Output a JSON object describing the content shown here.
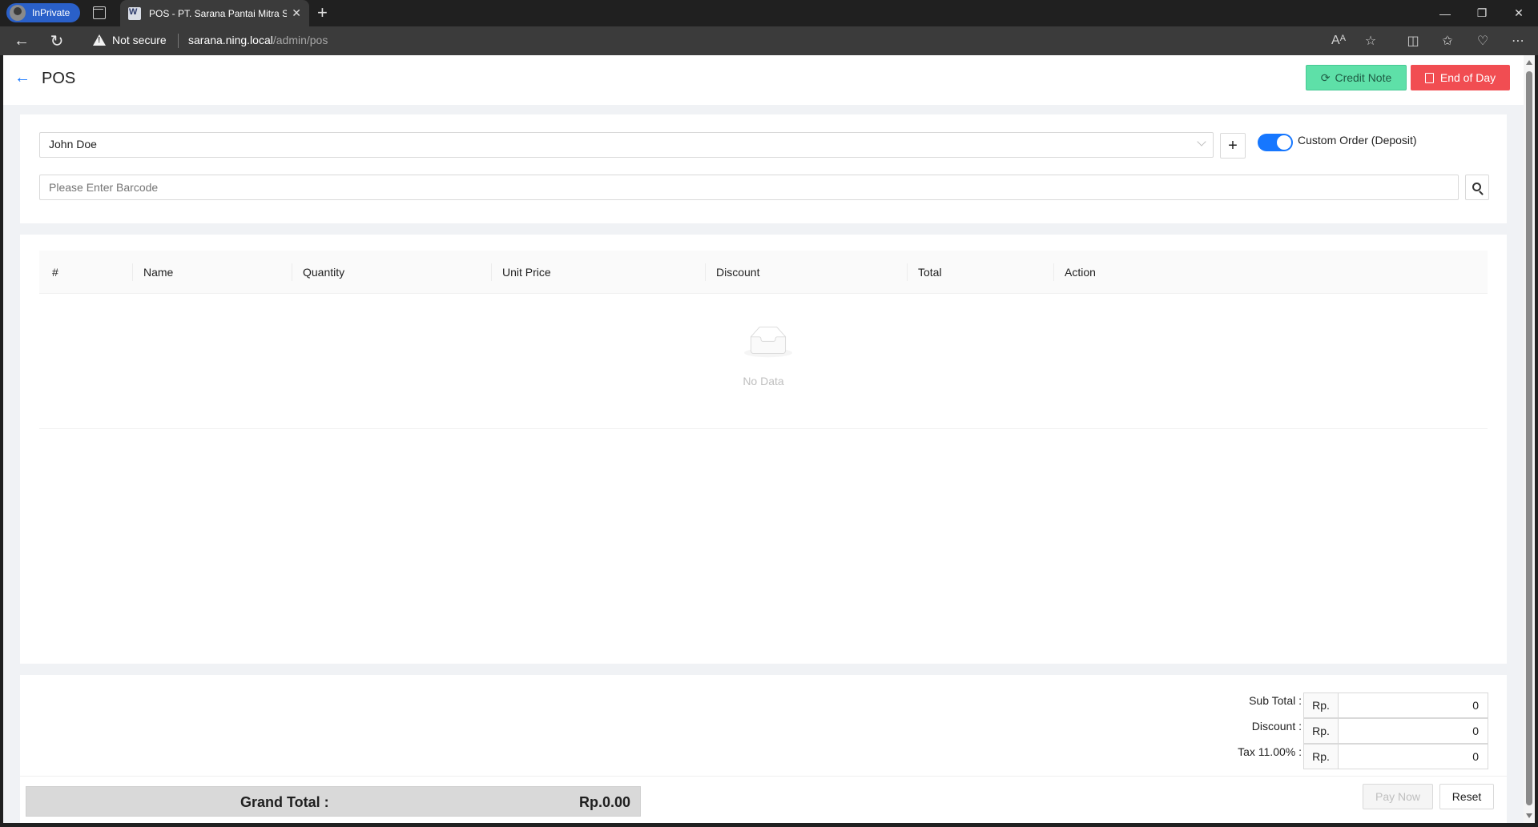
{
  "browser": {
    "inprivate_label": "InPrivate",
    "tab_title": "POS - PT. Sarana Pantai Mitra Se",
    "security_text": "Not secure",
    "url_host": "sarana.ning.local",
    "url_path": "/admin/pos"
  },
  "header": {
    "title": "POS",
    "credit_note_label": "Credit Note",
    "end_of_day_label": "End of Day"
  },
  "order": {
    "customer": "John Doe",
    "custom_order_label": "Custom Order (Deposit)",
    "custom_order_enabled": true,
    "barcode_placeholder": "Please Enter Barcode"
  },
  "table": {
    "columns": [
      "#",
      "Name",
      "Quantity",
      "Unit Price",
      "Discount",
      "Total",
      "Action"
    ],
    "rows": [],
    "empty_text": "No Data"
  },
  "summary": {
    "currency_prefix": "Rp.",
    "subtotal_label": "Sub Total :",
    "subtotal_value": "0",
    "discount_label": "Discount :",
    "discount_value": "0",
    "tax_label": "Tax 11.00% :",
    "tax_value": "0",
    "grand_total_label": "Grand Total :",
    "grand_total_value": "Rp.0.00",
    "pay_now_label": "Pay Now",
    "reset_label": "Reset"
  },
  "colors": {
    "primary": "#1677ff",
    "credit_note": "#5ee0a8",
    "end_of_day": "#f14d52"
  }
}
